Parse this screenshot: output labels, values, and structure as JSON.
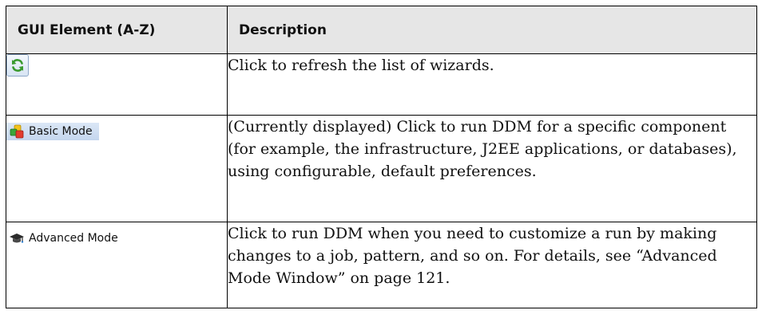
{
  "table": {
    "headers": {
      "element": "GUI Element (A-Z)",
      "description": "Description"
    },
    "rows": [
      {
        "element_icon": "refresh-icon",
        "element_label": "",
        "description": "Click to refresh the list of wizards."
      },
      {
        "element_icon": "basic-mode-icon",
        "element_label": "Basic Mode",
        "description": "(Currently displayed) Click to run DDM for a specific component (for example, the infrastructure, J2EE applications, or databases), using configurable, default preferences."
      },
      {
        "element_icon": "advanced-mode-icon",
        "element_label": "Advanced Mode",
        "description": "Click to run DDM when you need to customize a run by making changes to a job, pattern, and so on. For details, see “Advanced Mode Window” on page 121."
      }
    ]
  },
  "colors": {
    "header_bg": "#e6e6e6",
    "border": "#000000",
    "chip_bg": "#c9daf0",
    "refresh_green": "#3a9a2e"
  }
}
